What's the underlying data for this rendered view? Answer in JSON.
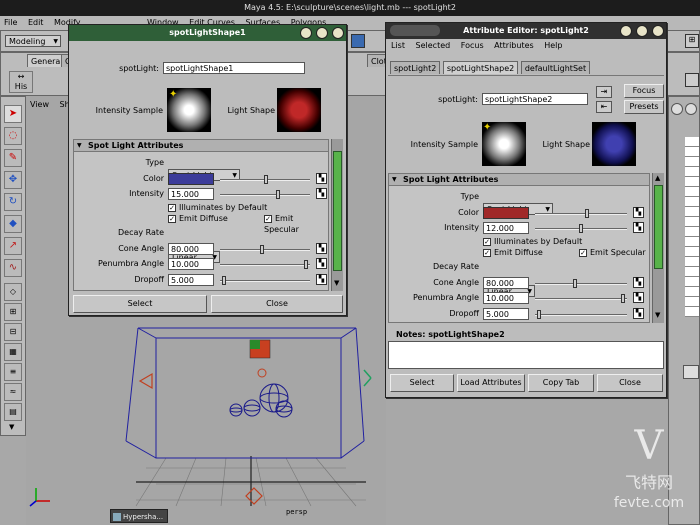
{
  "app": {
    "title": "Maya 4.5: E:\\sculpture\\scenes\\light.mb  ---  spotLight2",
    "menus": [
      "File",
      "Edit",
      "Modify",
      "Window",
      "Edit Curves",
      "Surfaces",
      "Polygons"
    ],
    "mode": "Modeling",
    "shelf_tabs": [
      "General",
      "C"
    ],
    "shelf_right_tab": "Clot",
    "view_menus": [
      "View",
      "Shad"
    ],
    "viewport_label": "persp",
    "hypershade_label": "Hypersha..."
  },
  "win1": {
    "title": "spotLightShape1",
    "node_label": "spotLight:",
    "node_value": "spotLightShape1",
    "intensity_sample": "Intensity Sample",
    "light_shape": "Light Shape",
    "section": "Spot Light Attributes",
    "type_label": "Type",
    "type_value": "Spot Light",
    "color_label": "Color",
    "color_hex": "#3c3c9a",
    "intensity_label": "Intensity",
    "intensity_value": "15.000",
    "illum_label": "Illuminates by Default",
    "diffuse_label": "Emit Diffuse",
    "specular_label": "Emit Specular",
    "decay_label": "Decay Rate",
    "decay_value": "Linear",
    "cone_label": "Cone Angle",
    "cone_value": "80.000",
    "penumbra_label": "Penumbra Angle",
    "penumbra_value": "10.000",
    "dropoff_label": "Dropoff",
    "dropoff_value": "5.000",
    "select_btn": "Select",
    "close_btn": "Close"
  },
  "win2": {
    "title": "Attribute Editor: spotLight2",
    "menus": [
      "List",
      "Selected",
      "Focus",
      "Attributes",
      "Help"
    ],
    "tabs": [
      "spotLight2",
      "spotLightShape2",
      "defaultLightSet"
    ],
    "node_label": "spotLight:",
    "node_value": "spotLightShape2",
    "focus_btn": "Focus",
    "presets_btn": "Presets",
    "intensity_sample": "Intensity Sample",
    "light_shape": "Light Shape",
    "section": "Spot Light Attributes",
    "type_label": "Type",
    "type_value": "Spot Light",
    "color_label": "Color",
    "color_hex": "#a02828",
    "intensity_label": "Intensity",
    "intensity_value": "12.000",
    "illum_label": "Illuminates by Default",
    "diffuse_label": "Emit Diffuse",
    "specular_label": "Emit Specular",
    "decay_label": "Decay Rate",
    "decay_value": "Linear",
    "cone_label": "Cone Angle",
    "cone_value": "80.000",
    "penumbra_label": "Penumbra Angle",
    "penumbra_value": "10.000",
    "dropoff_label": "Dropoff",
    "dropoff_value": "5.000",
    "notes_label": "Notes: spotLightShape2",
    "select_btn": "Select",
    "load_btn": "Load Attributes",
    "copy_btn": "Copy Tab",
    "close_btn": "Close"
  },
  "watermark": {
    "line1": "飞特网",
    "line2": "fevte.com"
  }
}
